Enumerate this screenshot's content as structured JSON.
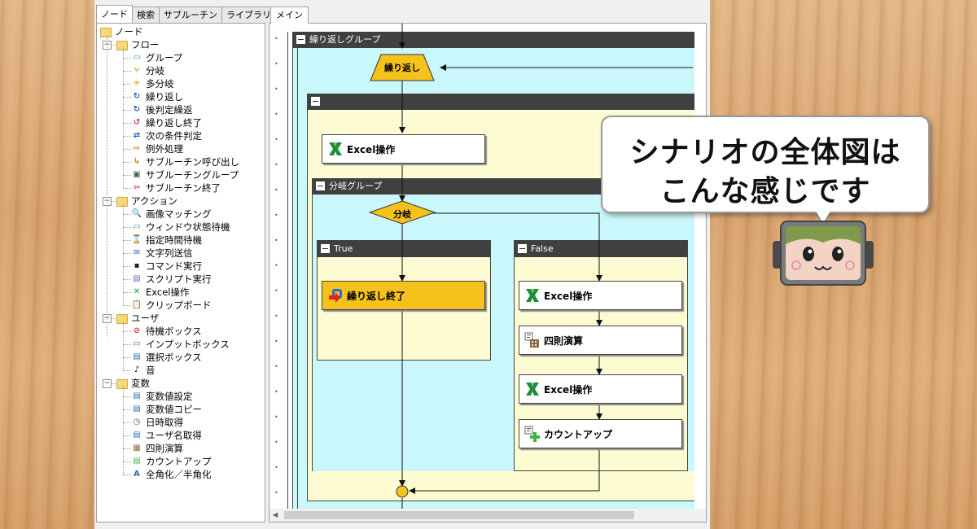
{
  "left_panel": {
    "tabs": [
      "ノード",
      "検索",
      "サブルーチン",
      "ライブラリ"
    ],
    "active_tab": "ノード",
    "tree": {
      "root": "ノード",
      "groups": [
        {
          "label": "フロー",
          "items": [
            "グループ",
            "分岐",
            "多分岐",
            "繰り返し",
            "後判定繰返",
            "繰り返し終了",
            "次の条件判定",
            "例外処理",
            "サブルーチン呼び出し",
            "サブルーチングループ",
            "サブルーチン終了"
          ]
        },
        {
          "label": "アクション",
          "items": [
            "画像マッチング",
            "ウィンドウ状態待機",
            "指定時間待機",
            "文字列送信",
            "コマンド実行",
            "スクリプト実行",
            "Excel操作",
            "クリップボード"
          ]
        },
        {
          "label": "ユーザ",
          "items": [
            "待機ボックス",
            "インプットボックス",
            "選択ボックス",
            "音"
          ]
        },
        {
          "label": "変数",
          "items": [
            "変数値設定",
            "変数値コピー",
            "日時取得",
            "ユーザ名取得",
            "四則演算",
            "カウントアップ",
            "全角化／半角化"
          ]
        }
      ]
    }
  },
  "main_panel": {
    "tab": "メイン",
    "loop_group": {
      "title": "繰り返しグループ"
    },
    "loop_node": "繰り返し",
    "inner_group": {
      "title": ""
    },
    "excel_node_top": "Excel操作",
    "branch_group": {
      "title": "分岐グループ"
    },
    "branch_node": "分岐",
    "true_group": {
      "title": "True",
      "node": "繰り返し終了"
    },
    "false_group": {
      "title": "False",
      "nodes": [
        "Excel操作",
        "四則演算",
        "Excel操作",
        "カウントアップ"
      ]
    }
  },
  "callout": {
    "line1": "シナリオの全体図は",
    "line2": "こんな感じです"
  },
  "colors": {
    "group_header": "#404040",
    "loop_bg": "#c9f7fb",
    "inner_bg": "#fdfbd2",
    "diamond_fill": "#f5c21b",
    "loop_end_fill": "#f5c21b",
    "excel_green": "#1f8f3a"
  }
}
